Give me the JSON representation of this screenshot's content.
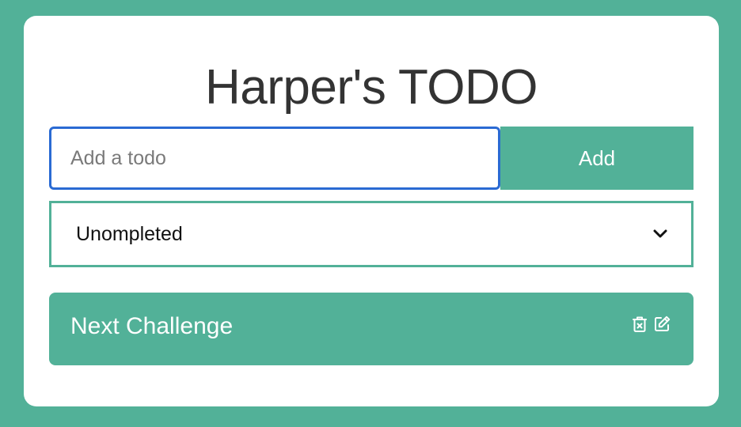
{
  "header": {
    "title": "Harper's TODO"
  },
  "form": {
    "input_value": "",
    "input_placeholder": "Add a todo",
    "add_label": "Add"
  },
  "filter": {
    "selected": "Unompleted",
    "icon": "chevron-down-icon"
  },
  "todos": [
    {
      "text": "Next Challenge",
      "icons": [
        "trash-icon",
        "edit-icon"
      ]
    }
  ],
  "colors": {
    "background": "#52b198",
    "card": "#ffffff",
    "accent": "#52b198",
    "focus_border": "#2a6ad3",
    "title_text": "#333333"
  }
}
